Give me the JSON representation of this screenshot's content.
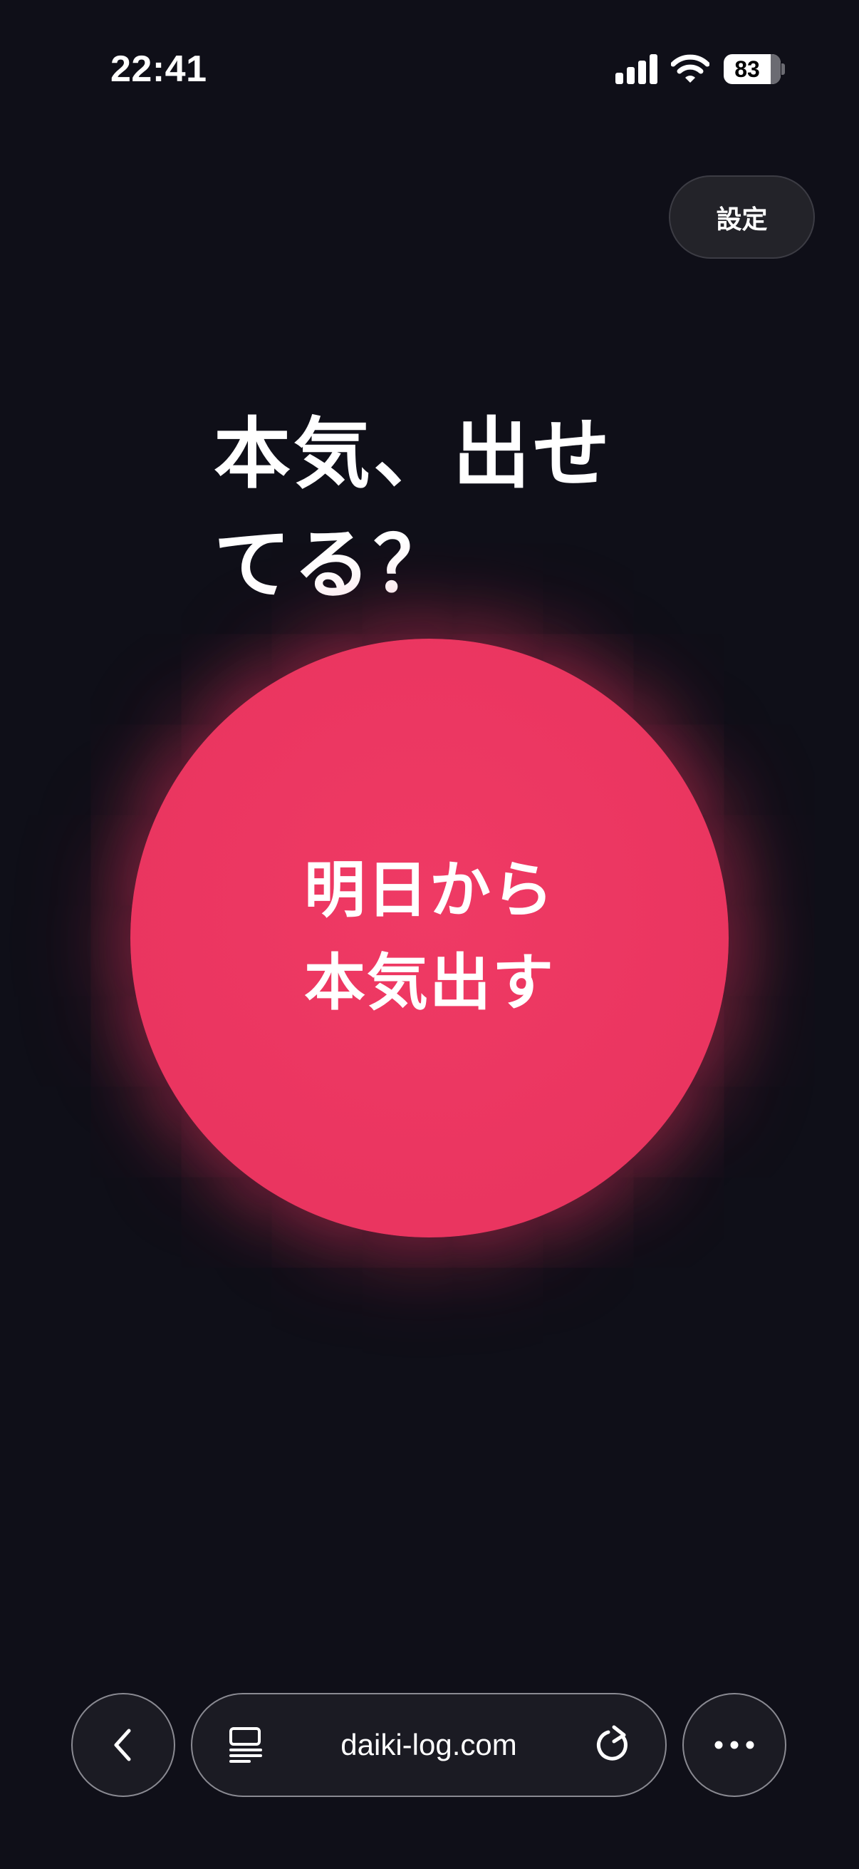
{
  "status_bar": {
    "time": "22:41",
    "battery": "83"
  },
  "settings_button": {
    "label": "設定"
  },
  "headline": "本気、出せ\nてる？",
  "main_button": {
    "label": "明日から\n本気出す",
    "color": "#EA3560"
  },
  "browser": {
    "url": "daiki-log.com",
    "icons": {
      "back": "chevron-left-icon",
      "reader": "reader-mode-icon",
      "reload": "reload-icon",
      "more": "more-icon"
    }
  },
  "colors": {
    "background": "#0F0F18",
    "accent": "#EA3560"
  }
}
